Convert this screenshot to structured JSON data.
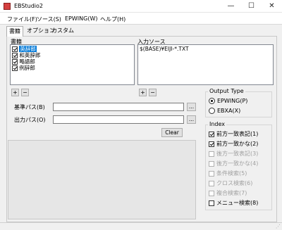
{
  "window": {
    "title": "EBStudio2",
    "minimize_glyph": "—",
    "maximize_glyph": "☐",
    "close_glyph": "✕"
  },
  "menu": [
    "ファイル(F)",
    "ソース(S)",
    "EPWING(W)",
    "ヘルプ(H)"
  ],
  "tabs": [
    "書籍",
    "オプション",
    "カスタム"
  ],
  "books": {
    "label": "書籍",
    "items": [
      {
        "label": "英辞郎",
        "checked": true,
        "selected": true
      },
      {
        "label": "和英辞郎",
        "checked": true,
        "selected": false
      },
      {
        "label": "略語郎",
        "checked": true,
        "selected": false
      },
      {
        "label": "例辞郎",
        "checked": true,
        "selected": false
      }
    ],
    "add_label": "+",
    "remove_label": "−"
  },
  "source": {
    "label": "入力ソース",
    "items": [
      "$(BASE)¥EIJI-*.TXT"
    ],
    "add_label": "+",
    "remove_label": "−"
  },
  "paths": {
    "base_label": "基準パス(B)",
    "base_value": "",
    "output_label": "出力パス(O)",
    "output_value": "",
    "browse_label": "..."
  },
  "clear_label": "Clear",
  "output_type": {
    "title": "Output Type",
    "options": [
      {
        "label": "EPWING(P)",
        "selected": true
      },
      {
        "label": "EBXA(X)",
        "selected": false
      }
    ]
  },
  "index": {
    "title": "Index",
    "items": [
      {
        "label": "前方一致表記(1)",
        "checked": true,
        "enabled": true
      },
      {
        "label": "前方一致かな(2)",
        "checked": true,
        "enabled": true
      },
      {
        "label": "後方一致表記(3)",
        "checked": false,
        "enabled": false
      },
      {
        "label": "後方一致かな(4)",
        "checked": false,
        "enabled": false
      },
      {
        "label": "条件検索(5)",
        "checked": false,
        "enabled": false
      },
      {
        "label": "クロス検索(6)",
        "checked": false,
        "enabled": false
      },
      {
        "label": "複合検索(7)",
        "checked": false,
        "enabled": false
      },
      {
        "label": "メニュー検索(8)",
        "checked": false,
        "enabled": true
      }
    ]
  }
}
